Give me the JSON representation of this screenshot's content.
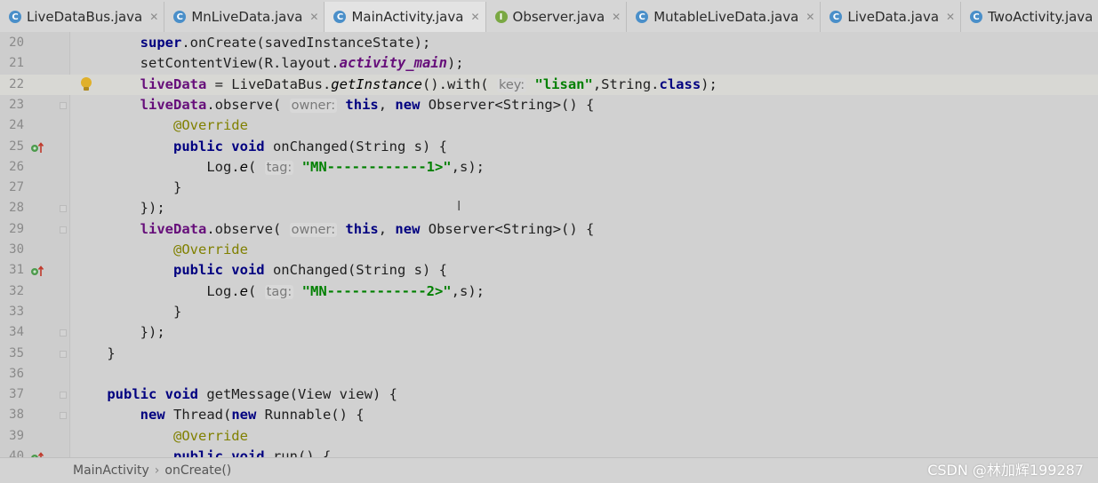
{
  "tabs": [
    {
      "label": "LiveDataBus.java",
      "icon": "class-icon",
      "letter": "C",
      "active": false
    },
    {
      "label": "MnLiveData.java",
      "icon": "class-icon",
      "letter": "C",
      "active": false
    },
    {
      "label": "MainActivity.java",
      "icon": "class-icon",
      "letter": "C",
      "active": true
    },
    {
      "label": "Observer.java",
      "icon": "interface-icon",
      "letter": "I",
      "active": false
    },
    {
      "label": "MutableLiveData.java",
      "icon": "class-icon",
      "letter": "C",
      "active": false
    },
    {
      "label": "LiveData.java",
      "icon": "class-icon",
      "letter": "C",
      "active": false
    },
    {
      "label": "TwoActivity.java",
      "icon": "class-icon",
      "letter": "C",
      "active": false
    }
  ],
  "lines": [
    {
      "n": "20",
      "segs": [
        [
          "",
          "        "
        ],
        [
          "kw",
          "super"
        ],
        [
          "plain",
          ".onCreate(savedInstanceState);"
        ]
      ]
    },
    {
      "n": "21",
      "segs": [
        [
          "",
          "        "
        ],
        [
          "plain",
          "setContentView(R.layout."
        ],
        [
          "fldi",
          "activity_main"
        ],
        [
          "plain",
          ");"
        ]
      ]
    },
    {
      "n": "22",
      "current": true,
      "bulb": true,
      "segs": [
        [
          "",
          "        "
        ],
        [
          "fld",
          "liveData"
        ],
        [
          "plain",
          " = LiveDataBus."
        ],
        [
          "ital",
          "getInstance"
        ],
        [
          "plain",
          "().with( "
        ],
        [
          "hint",
          "key:"
        ],
        [
          "plain",
          " "
        ],
        [
          "str",
          "\"lisan\""
        ],
        [
          "plain",
          ",String."
        ],
        [
          "kw",
          "class"
        ],
        [
          "plain",
          ");"
        ]
      ]
    },
    {
      "n": "23",
      "fold": true,
      "segs": [
        [
          "",
          "        "
        ],
        [
          "fld",
          "liveData"
        ],
        [
          "plain",
          ".observe( "
        ],
        [
          "hint",
          "owner:"
        ],
        [
          "plain",
          " "
        ],
        [
          "kw",
          "this"
        ],
        [
          "plain",
          ", "
        ],
        [
          "kw",
          "new"
        ],
        [
          "plain",
          " Observer<String>() {"
        ]
      ]
    },
    {
      "n": "24",
      "segs": [
        [
          "",
          "            "
        ],
        [
          "ann",
          "@Override"
        ]
      ]
    },
    {
      "n": "25",
      "gutter": "override",
      "segs": [
        [
          "",
          "            "
        ],
        [
          "kw",
          "public void"
        ],
        [
          "plain",
          " onChanged(String s) {"
        ]
      ]
    },
    {
      "n": "26",
      "segs": [
        [
          "",
          "                "
        ],
        [
          "plain",
          "Log."
        ],
        [
          "ital",
          "e"
        ],
        [
          "plain",
          "( "
        ],
        [
          "hint",
          "tag:"
        ],
        [
          "plain",
          " "
        ],
        [
          "str",
          "\"MN------------1>\""
        ],
        [
          "plain",
          ",s);"
        ]
      ]
    },
    {
      "n": "27",
      "segs": [
        [
          "",
          "            "
        ],
        [
          "plain",
          "}"
        ]
      ]
    },
    {
      "n": "28",
      "fold": true,
      "segs": [
        [
          "",
          "        "
        ],
        [
          "plain",
          "});"
        ]
      ]
    },
    {
      "n": "29",
      "fold": true,
      "segs": [
        [
          "",
          "        "
        ],
        [
          "fld",
          "liveData"
        ],
        [
          "plain",
          ".observe( "
        ],
        [
          "hint",
          "owner:"
        ],
        [
          "plain",
          " "
        ],
        [
          "kw",
          "this"
        ],
        [
          "plain",
          ", "
        ],
        [
          "kw",
          "new"
        ],
        [
          "plain",
          " Observer<String>() {"
        ]
      ]
    },
    {
      "n": "30",
      "segs": [
        [
          "",
          "            "
        ],
        [
          "ann",
          "@Override"
        ]
      ]
    },
    {
      "n": "31",
      "gutter": "override",
      "segs": [
        [
          "",
          "            "
        ],
        [
          "kw",
          "public void"
        ],
        [
          "plain",
          " onChanged(String s) {"
        ]
      ]
    },
    {
      "n": "32",
      "segs": [
        [
          "",
          "                "
        ],
        [
          "plain",
          "Log."
        ],
        [
          "ital",
          "e"
        ],
        [
          "plain",
          "( "
        ],
        [
          "hint",
          "tag:"
        ],
        [
          "plain",
          " "
        ],
        [
          "str",
          "\"MN------------2>\""
        ],
        [
          "plain",
          ",s);"
        ]
      ]
    },
    {
      "n": "33",
      "segs": [
        [
          "",
          "            "
        ],
        [
          "plain",
          "}"
        ]
      ]
    },
    {
      "n": "34",
      "fold": true,
      "segs": [
        [
          "",
          "        "
        ],
        [
          "plain",
          "});"
        ]
      ]
    },
    {
      "n": "35",
      "fold": true,
      "segs": [
        [
          "",
          "    "
        ],
        [
          "plain",
          "}"
        ]
      ]
    },
    {
      "n": "36",
      "segs": []
    },
    {
      "n": "37",
      "fold": true,
      "segs": [
        [
          "",
          "    "
        ],
        [
          "kw",
          "public void"
        ],
        [
          "plain",
          " getMessage(View view) {"
        ]
      ]
    },
    {
      "n": "38",
      "fold": true,
      "segs": [
        [
          "",
          "        "
        ],
        [
          "kw",
          "new"
        ],
        [
          "plain",
          " Thread("
        ],
        [
          "kw",
          "new"
        ],
        [
          "plain",
          " Runnable() {"
        ]
      ]
    },
    {
      "n": "39",
      "segs": [
        [
          "",
          "            "
        ],
        [
          "ann",
          "@Override"
        ]
      ]
    },
    {
      "n": "40",
      "gutter": "override",
      "segs": [
        [
          "",
          "            "
        ],
        [
          "kw",
          "public void"
        ],
        [
          "plain",
          " run() {"
        ]
      ]
    }
  ],
  "breadcrumb": {
    "items": [
      "MainActivity",
      "onCreate()"
    ]
  },
  "watermark": "CSDN @林加辉199287",
  "colors": {
    "keyword": "#000080",
    "field": "#660e7a",
    "string": "#008000",
    "annotation": "#808000"
  }
}
